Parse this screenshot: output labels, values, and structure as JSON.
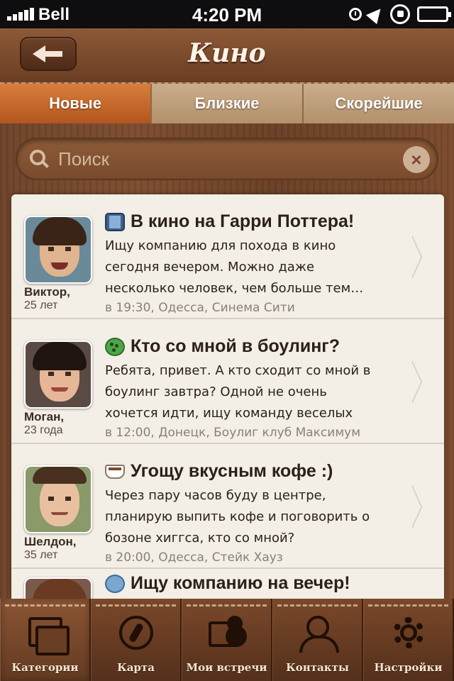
{
  "status_bar": {
    "carrier": "Bell",
    "time": "4:20 PM",
    "icons": [
      "signal-icon",
      "alarm-icon",
      "location-icon",
      "lock-rotation-icon",
      "battery-icon"
    ]
  },
  "nav": {
    "title": "Кино",
    "back_icon": "back-arrow-icon"
  },
  "tabs": [
    {
      "label": "Новые",
      "active": true
    },
    {
      "label": "Близкие",
      "active": false
    },
    {
      "label": "Скорейшие",
      "active": false
    }
  ],
  "search": {
    "placeholder": "Поиск",
    "value": ""
  },
  "listings": [
    {
      "category_icon": "film-icon",
      "title": "В кино на Гарри Поттера!",
      "description": "Ищу компанию для похода в кино сегодня вечером. Можно даже несколько человек, чем больше тем…",
      "meta": "в 19:30, Одесса, Синема Сити",
      "author": "Виктор,",
      "age": "25 лет"
    },
    {
      "category_icon": "bowling-icon",
      "title": "Кто со мной в боулинг?",
      "description": "Ребята, привет. А кто сходит со мной в боулинг завтра? Одной не очень хочется идти, ищу команду веселых л…",
      "meta": "в 12:00, Донецк, Боулиг клуб Максимум",
      "author": "Моган,",
      "age": "23 года"
    },
    {
      "category_icon": "coffee-icon",
      "title": "Угощу вкусным кофе :)",
      "description": "Через пару часов буду в центре, планирую выпить кофе и поговорить о бозоне хиггса, кто со мной?",
      "meta": "в 20:00, Одесса, Стейк Хауз",
      "author": "Шелдон,",
      "age": "35 лет"
    },
    {
      "category_icon": "globe-icon",
      "title": "Ищу компанию на вечер!"
    }
  ],
  "tabbar": [
    {
      "label": "Категории",
      "icon": "categories-icon",
      "active": true
    },
    {
      "label": "Карта",
      "icon": "compass-icon",
      "active": false
    },
    {
      "label": "Мои встречи",
      "icon": "meetings-icon",
      "active": false
    },
    {
      "label": "Контакты",
      "icon": "contacts-icon",
      "active": false
    },
    {
      "label": "Настройки",
      "icon": "gear-icon",
      "active": false
    }
  ],
  "colors": {
    "wood": "#7a4a2d",
    "active_tab": "#c5692c",
    "list_bg": "#f1ece4"
  }
}
